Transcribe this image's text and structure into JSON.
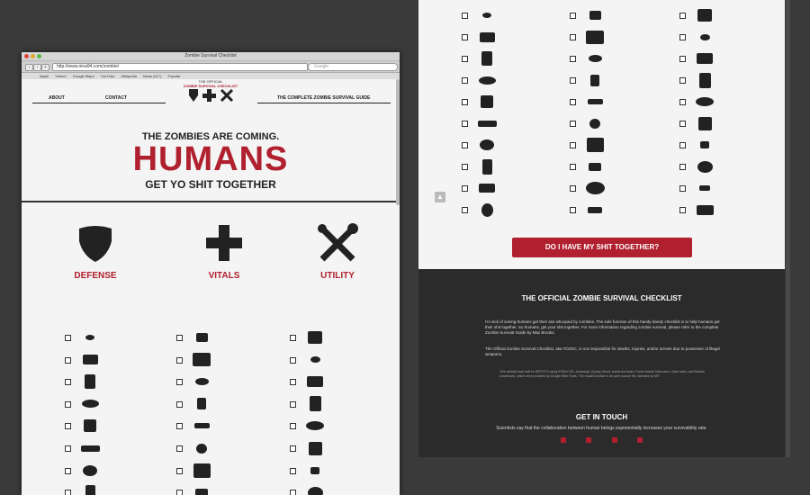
{
  "browser": {
    "window_title": "Zombie Survival Checklist",
    "url": "http://www.nina94.com/zombie/",
    "search_placeholder": "Google",
    "bookmarks": [
      "Apple",
      "Yahoo!",
      "Google Maps",
      "YouTube",
      "Wikipedia",
      "News (417)",
      "Popular"
    ]
  },
  "site": {
    "nav": {
      "about": "ABOUT",
      "contact": "CONTACT",
      "guide": "THE COMPLETE ZOMBIE SURVIVAL GUIDE"
    },
    "logo": {
      "top": "THE OFFICIAL",
      "main": "ZOMBIE SURVIVAL CHECKLIST"
    },
    "hero": {
      "line1": "THE ZOMBIES ARE COMING.",
      "line2": "HUMANS",
      "line3": "GET YO SHIT TOGETHER"
    },
    "categories": [
      "DEFENSE",
      "VITALS",
      "UTILITY"
    ],
    "button_label": "DO I HAVE MY SHIT TOGETHER?",
    "footer": {
      "title": "THE OFFICIAL ZOMBIE SURVIVAL CHECKLIST",
      "para1": "I'm sick of seeing humans get their ass whooped by zombies. The sole function of this handy-dandy checklist is to help humans get their shit together. So humans, get your shit together. For more information regarding zombie survival, please refer to the complete Zombie Survival Guide by Max Brooks.",
      "para2": "The Official Zombie Survival Checklist, aka TOZSC, is not responsible for deaths, injuries, and/or arrests due to possesion of illegal weapons.",
      "credits": "This website was built for ART2273 using HTML/CSS, Javascript, jQuery, blood, sweat and tears. Fonts include Noto sans, Open sans, and Roboto condensed, which were provided by Google Web Fonts. The modal function is an open source file, licensed by MIT.",
      "contact_title": "GET IN TOUCH",
      "contact_text": "Scientists say that the collaboration between human beings exponentially increases your survivability rate."
    },
    "social_icons": [
      "facebook-icon",
      "twitter-icon",
      "youtube-icon",
      "linkedin-icon"
    ]
  },
  "colors": {
    "accent": "#b0202e",
    "dark": "#2b2b2b",
    "page": "#f4f4f4"
  }
}
